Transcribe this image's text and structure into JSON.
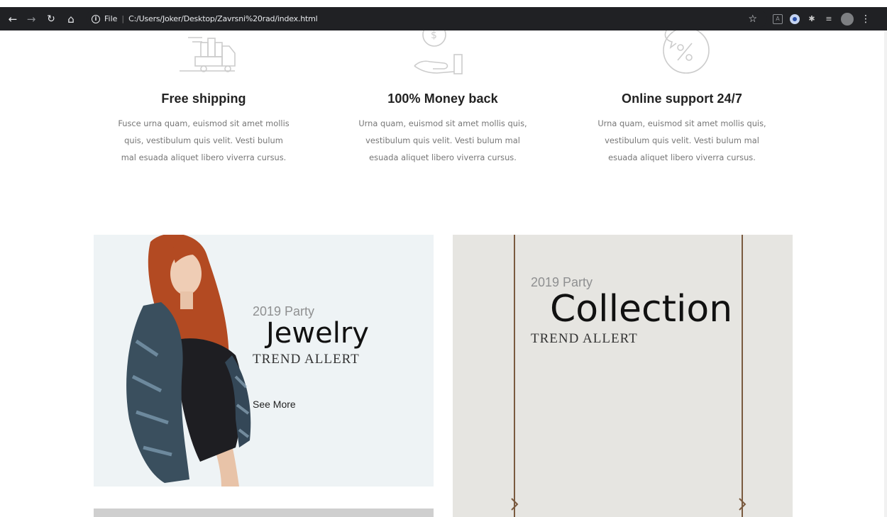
{
  "browser": {
    "file_label": "File",
    "url": "C:/Users/Joker/Desktop/Zavrsni%20rad/index.html"
  },
  "features": [
    {
      "title": "Free shipping",
      "lines": [
        "Fusce urna quam, euismod sit amet mollis",
        "quis, vestibulum quis velit. Vesti bulum",
        "mal esuada aliquet libero viverra cursus."
      ],
      "icon": "delivery-truck-icon"
    },
    {
      "title": "100% Money back",
      "lines": [
        "Urna quam, euismod sit amet mollis quis,",
        "vestibulum quis velit. Vesti bulum mal",
        "esuada aliquet libero viverra cursus."
      ],
      "icon": "money-back-hand-icon"
    },
    {
      "title": "Online support 24/7",
      "lines": [
        "Urna quam, euismod sit amet mollis quis,",
        "vestibulum quis velit. Vesti bulum mal",
        "esuada aliquet libero viverra cursus."
      ],
      "icon": "support-chat-icon"
    }
  ],
  "banners": {
    "left": {
      "eyebrow": "2019 Party",
      "title": "Jewelry",
      "subtitle": "TREND ALLERT",
      "cta": "See More"
    },
    "right": {
      "eyebrow": "2019 Party",
      "title": "Collection",
      "subtitle": "TREND ALLERT"
    }
  },
  "colors": {
    "chrome_bg": "#202124",
    "feature_icon": "#cccccc",
    "banner_left_bg": "#eef3f5",
    "banner_right_bg": "#e6e5e1"
  }
}
